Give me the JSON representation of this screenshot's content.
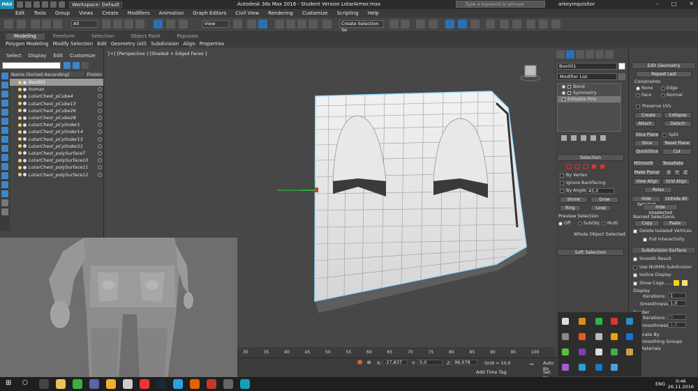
{
  "titlebar": {
    "logo": "MAX",
    "workspace": "Workspace: Default",
    "app_title": "Autodesk 3ds Max 2016 - Student Version    LotarArmor.max",
    "search_placeholder": "Type a keyword or phrase",
    "user": "arkeyinquisitor",
    "minimize": "–",
    "maximize": "□",
    "close": "✕"
  },
  "menus": [
    "Edit",
    "Tools",
    "Group",
    "Views",
    "Create",
    "Modifiers",
    "Animation",
    "Graph Editors",
    "Civil View",
    "Rendering",
    "Customize",
    "Scripting",
    "Help"
  ],
  "toolbar": {
    "filter_select": "All",
    "ref_coord": "View",
    "selection_set": "Create Selection Se"
  },
  "ribbon": {
    "tabs": [
      "Modeling",
      "Freeform",
      "Selection",
      "Object Paint",
      "Populate"
    ],
    "active_tab": "Modeling",
    "sub": [
      "Polygon Modeling",
      "Modify Selection",
      "Edit",
      "Geometry (All)",
      "Subdivision",
      "Align",
      "Properties"
    ]
  },
  "explorer": {
    "tabs": [
      "Select",
      "Display",
      "Edit",
      "Customize"
    ],
    "col_name": "Name (Sorted Ascending)",
    "col_frozen": "Frozen",
    "rows": [
      {
        "name": "Box001",
        "selected": true
      },
      {
        "name": "human",
        "selected": false
      },
      {
        "name": "LotarChest_pCube4",
        "selected": false
      },
      {
        "name": "LotarChest_pCube13",
        "selected": false
      },
      {
        "name": "LotarChest_pCube26",
        "selected": false
      },
      {
        "name": "LotarChest_pCube28",
        "selected": false
      },
      {
        "name": "LotarChest_pCylinder1",
        "selected": false
      },
      {
        "name": "LotarChest_pCylinder14",
        "selected": false
      },
      {
        "name": "LotarChest_pCylinder15",
        "selected": false
      },
      {
        "name": "LotarChest_pCylinder21",
        "selected": false
      },
      {
        "name": "LotarChest_polySurface7",
        "selected": false
      },
      {
        "name": "LotarChest_polySurface10",
        "selected": false
      },
      {
        "name": "LotarChest_polySurface11",
        "selected": false
      },
      {
        "name": "LotarChest_polySurface12",
        "selected": false
      }
    ]
  },
  "viewport": {
    "label": "[+] [Perspective ] [Shaded + Edged Faces ]"
  },
  "timeline": {
    "ticks": [
      "50",
      "55",
      "60",
      "65",
      "70",
      "75",
      "80",
      "85",
      "90",
      "95",
      "100"
    ],
    "tick_prefix": [
      "30",
      "35",
      "40",
      "45"
    ]
  },
  "status": {
    "x_label": "X:",
    "x_value": "-27,837",
    "y_label": "Y:",
    "y_value": "0,0",
    "z_label": "Z:",
    "z_value": "99,078",
    "grid": "Grid = 10,0",
    "add_time_tag": "Add Time Tag",
    "auto_key": "Auto Ke",
    "set_key": "Set Ke"
  },
  "cmdpanel": {
    "object_name": "Box001",
    "modifier_list": "Modifier List",
    "stack": [
      {
        "name": "Bend",
        "selected": false
      },
      {
        "name": "Symmetry",
        "selected": false
      },
      {
        "name": "Editable Poly",
        "selected": true
      }
    ],
    "selection_header": "Selection",
    "by_vertex": "By Vertex",
    "ignore_backfacing": "Ignore Backfacing",
    "by_angle": "By Angle:",
    "by_angle_value": "45,0",
    "shrink": "Shrink",
    "grow": "Grow",
    "ring": "Ring",
    "loop": "Loop",
    "preview_selection": "Preview Selection",
    "off": "Off",
    "subobj": "SubObj",
    "multi": "Multi",
    "whole_object": "Whole Object Selected",
    "soft_selection": "Soft Selection"
  },
  "editgeo": {
    "header": "Edit Geometry",
    "repeat_last": "Repeat Last",
    "constraints": "Constraints",
    "none": "None",
    "edge": "Edge",
    "face": "Face",
    "normal": "Normal",
    "preserve_uvs": "Preserve UVs",
    "create": "Create",
    "collapse": "Collapse",
    "attach": "Attach",
    "detach": "Detach",
    "slice_plane": "Slice Plane",
    "split": "Split",
    "slice": "Slice",
    "reset_plane": "Reset Plane",
    "quickslice": "QuickSlice",
    "cut": "Cut",
    "msmooth": "MSmooth",
    "tessellate": "Tessellate",
    "make_planar": "Make Planar",
    "x": "X",
    "y": "Y",
    "z": "Z",
    "view_align": "View Align",
    "grid_align": "Grid Align",
    "relax": "Relax",
    "hide_selected": "Hide Selected",
    "unhide_all": "Unhide All",
    "hide_unselected": "Hide Unselected",
    "named_selections": "Named Selections:",
    "copy": "Copy",
    "paste": "Paste",
    "delete_isolated": "Delete Isolated Vertices",
    "full_interactivity": "Full Interactivity",
    "subdiv_header": "Subdivision Surface",
    "smooth_result": "Smooth Result",
    "use_nurms": "Use NURMS Subdivision",
    "isoline_display": "Isoline Display",
    "show_cage": "Show Cage......",
    "display": "Display",
    "iterations_label": "Iterations:",
    "iterations_value": "1",
    "smoothness_label": "Smoothness:",
    "smoothness_value": "1,0",
    "render": "Render",
    "r_iterations_value": "0",
    "r_smoothness_value": "1,0",
    "separate_by": "eparate By",
    "smoothing_groups": "Smoothing Groups",
    "materials": "Materials"
  },
  "taskbar": {
    "lang": "ENG",
    "time": "0:46",
    "date": "26.11.2016"
  },
  "colors": {
    "accent": "#2d6fb0",
    "selection_wire": "#7fd3ff",
    "cage_yellow": "#f5d419"
  }
}
